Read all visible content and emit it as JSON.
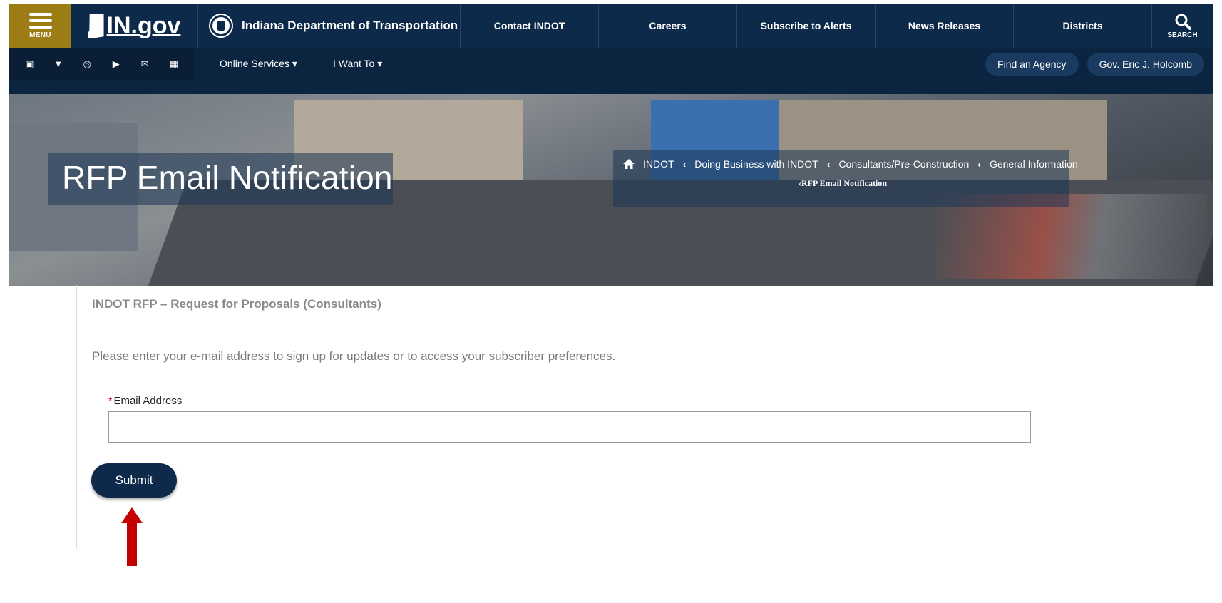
{
  "header": {
    "menu_label": "MENU",
    "logo_text": "IN.gov",
    "agency_name": "Indiana Department of Transportation",
    "nav": [
      "Contact INDOT",
      "Careers",
      "Subscribe to Alerts",
      "News Releases",
      "Districts"
    ],
    "search_label": "SEARCH"
  },
  "subbar": {
    "social_icons": [
      "facebook-icon",
      "twitter-icon",
      "instagram-icon",
      "youtube-icon",
      "email-icon",
      "calendar-icon"
    ],
    "online_services": "Online Services ▾",
    "i_want_to": "I Want To ▾",
    "find_agency": "Find an Agency",
    "governor": "Gov. Eric J. Holcomb"
  },
  "hero": {
    "title": "RFP Email Notification",
    "breadcrumbs": [
      "INDOT",
      "Doing Business with INDOT",
      "Consultants/Pre-Construction",
      "General Information"
    ],
    "current": "RFP Email Notification"
  },
  "content": {
    "heading": "INDOT RFP – Request for Proposals (Consultants)",
    "intro": "Please enter your e-mail address to sign up for updates or to access your subscriber preferences.",
    "email_label": "Email Address",
    "email_value": "",
    "submit_label": "Submit"
  },
  "colors": {
    "navy": "#0e2a4a",
    "gold": "#9c7c14",
    "required": "#c8102e",
    "arrow": "#c40000"
  }
}
